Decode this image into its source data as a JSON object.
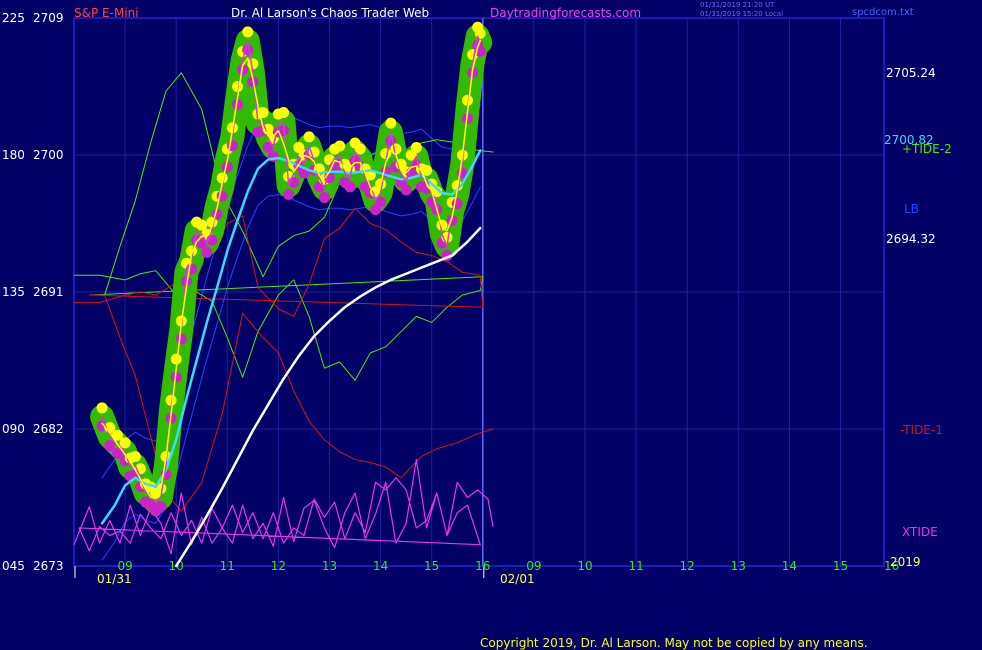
{
  "header": {
    "instrument": "S&P E-Mini",
    "title": "Dr. Al Larson's Chaos Trader Web",
    "site": "Daytradingforecasts.com",
    "timestamp_1": "01/31/2019 21:20 UT",
    "timestamp_2": "01/31/2019 15:20 Local",
    "file": "spcdcom.txt"
  },
  "footer": {
    "copyright": "Copyright 2019, Dr. Al Larson. May not be copied by any means."
  },
  "colors": {
    "background": "#000066",
    "grid": "#1f1fa0",
    "frame": "#2222dd",
    "price_dots_high": "#ffff00",
    "price_dots_low": "#cc22cc",
    "price_band": "#33bb00",
    "fast_ma": "#ffff00",
    "price_line": "#cc44cc",
    "cyan_ma": "#33ddff",
    "white_ma": "#ffffff",
    "blue_band": "#2244ff",
    "tide_plus": "#44ee00",
    "tide_minus": "#dd1111",
    "xtide": "#ee33ee"
  },
  "chart_data": {
    "type": "line",
    "title": "S&P E-Mini",
    "y_left_scale": [
      "225",
      "180",
      "135",
      "090",
      "045"
    ],
    "y_price_scale": [
      "2709",
      "2700",
      "2691",
      "2682",
      "2673"
    ],
    "y_right_labels": [
      "2705.24",
      "2700.82",
      "2694.32"
    ],
    "indicator_labels": [
      "+TIDE-2",
      "LB",
      "-TIDE-1",
      "XTIDE",
      "2019"
    ],
    "x_hours": [
      "09",
      "10",
      "11",
      "12",
      "13",
      "14",
      "15",
      "16",
      "09",
      "10",
      "11",
      "12",
      "13",
      "14",
      "15",
      "16"
    ],
    "x_dates": [
      "01/31",
      "02/01"
    ],
    "ylim": [
      2673,
      2709
    ],
    "forecast_start_hour": 16,
    "series": [
      {
        "name": "price",
        "x": [
          8.55,
          8.7,
          8.85,
          9.0,
          9.1,
          9.2,
          9.3,
          9.4,
          9.5,
          9.6,
          9.7,
          9.8,
          9.9,
          10.0,
          10.1,
          10.2,
          10.3,
          10.4,
          10.5,
          10.6,
          10.7,
          10.8,
          10.9,
          11.0,
          11.1,
          11.2,
          11.3,
          11.4,
          11.5,
          11.6,
          11.7,
          11.8,
          11.9,
          12.0,
          12.1,
          12.2,
          12.3,
          12.4,
          12.5,
          12.6,
          12.7,
          12.8,
          12.9,
          13.0,
          13.1,
          13.2,
          13.3,
          13.4,
          13.5,
          13.6,
          13.7,
          13.8,
          13.9,
          14.0,
          14.1,
          14.2,
          14.3,
          14.4,
          14.5,
          14.6,
          14.7,
          14.8,
          14.9,
          15.0,
          15.1,
          15.2,
          15.3,
          15.4,
          15.5,
          15.6,
          15.7,
          15.8,
          15.9,
          15.95
        ],
        "values": [
          2682.8,
          2681.5,
          2681.0,
          2680.5,
          2679.5,
          2679.6,
          2678.8,
          2677.8,
          2677.6,
          2677.2,
          2677.5,
          2679.6,
          2683.3,
          2686.0,
          2688.5,
          2692.3,
          2693.1,
          2695.0,
          2694.8,
          2694.2,
          2695.0,
          2696.7,
          2697.9,
          2699.8,
          2701.2,
          2703.9,
          2706.2,
          2707.5,
          2705.4,
          2702.1,
          2702.2,
          2701.1,
          2700.5,
          2702.1,
          2702.2,
          2698.0,
          2698.8,
          2699.9,
          2699.4,
          2700.6,
          2699.6,
          2698.5,
          2697.8,
          2699.1,
          2699.8,
          2700.0,
          2698.8,
          2698.5,
          2700.2,
          2699.8,
          2698.5,
          2698.1,
          2697.0,
          2697.5,
          2699.5,
          2701.5,
          2699.8,
          2698.8,
          2698.3,
          2699.4,
          2699.9,
          2698.5,
          2698.4,
          2697.5,
          2697.0,
          2694.8,
          2694.0,
          2696.3,
          2697.4,
          2699.4,
          2703.0,
          2706.0,
          2707.8,
          2707.4
        ]
      },
      {
        "name": "cyan_ma",
        "x": [
          8.55,
          8.8,
          9.0,
          9.2,
          9.4,
          9.6,
          9.8,
          10.0,
          10.2,
          10.4,
          10.6,
          10.8,
          11.0,
          11.2,
          11.4,
          11.6,
          11.8,
          12.0,
          12.2,
          12.4,
          12.6,
          12.8,
          13.0,
          13.2,
          13.4,
          13.6,
          13.8,
          14.0,
          14.2,
          14.4,
          14.6,
          14.8,
          15.0,
          15.2,
          15.4,
          15.6,
          15.8,
          15.95
        ],
        "values": [
          2675.8,
          2677.0,
          2678.3,
          2678.8,
          2678.4,
          2678.2,
          2679.3,
          2681.3,
          2684.0,
          2686.5,
          2689.0,
          2691.3,
          2693.7,
          2695.7,
          2697.6,
          2699.1,
          2699.7,
          2699.8,
          2699.6,
          2699.3,
          2699.0,
          2698.8,
          2698.9,
          2698.9,
          2698.8,
          2698.9,
          2699.0,
          2698.8,
          2698.6,
          2698.4,
          2698.5,
          2698.7,
          2698.1,
          2697.5,
          2697.4,
          2698.1,
          2699.3,
          2700.3
        ]
      },
      {
        "name": "white_ma",
        "x": [
          10.0,
          10.3,
          10.6,
          10.9,
          11.2,
          11.5,
          11.8,
          12.1,
          12.4,
          12.7,
          13.0,
          13.3,
          13.6,
          13.9,
          14.2,
          14.5,
          14.8,
          15.1,
          15.4,
          15.7,
          15.95
        ],
        "values": [
          2673.0,
          2674.6,
          2676.3,
          2678.1,
          2680.0,
          2681.9,
          2683.6,
          2685.3,
          2686.8,
          2688.1,
          2689.1,
          2690.0,
          2690.7,
          2691.3,
          2691.8,
          2692.2,
          2692.6,
          2693.0,
          2693.4,
          2694.3,
          2695.2
        ]
      },
      {
        "name": "+TIDE-2",
        "x": [
          8.0,
          8.5,
          9.0,
          9.3,
          9.6,
          10.0,
          10.4,
          10.7,
          11.0,
          11.3,
          11.6,
          12.0,
          12.3,
          12.6,
          12.9,
          13.2,
          13.5,
          13.8,
          14.1,
          14.4,
          14.7,
          15.0,
          15.3,
          15.6,
          15.95,
          16.0,
          16.3,
          16.6,
          16.9,
          17.2,
          17.5,
          17.8,
          18.1,
          18.5,
          18.9,
          19.3,
          19.7,
          20.0,
          20.3,
          20.6,
          20.9,
          21.2,
          21.5,
          21.8,
          22.1,
          22.4,
          22.8,
          23.1,
          23.5,
          23.9,
          24.2
        ],
        "values": [
          2692.1,
          2692.1,
          2691.8,
          2692.2,
          2692.4,
          2690.8,
          2691.0,
          2690.4,
          2688.0,
          2685.4,
          2688.4,
          2690.8,
          2691.8,
          2689.4,
          2686.0,
          2686.4,
          2685.2,
          2687.0,
          2687.4,
          2688.4,
          2689.4,
          2689.0,
          2690.0,
          2690.8,
          2691.1,
          2692.0,
          2690.8,
          2690.8,
          2694.0,
          2697.0,
          2700.8,
          2704.2,
          2705.4,
          2703.0,
          2697.5,
          2695.0,
          2692.0,
          2694.0,
          2694.7,
          2695.0,
          2695.9,
          2698.2,
          2699.8,
          2700.0,
          2700.4,
          2700.2,
          2700.8,
          2701.0,
          2700.8,
          2700.3,
          2700.2
        ]
      },
      {
        "name": "-TIDE-1",
        "x": [
          8.0,
          8.5,
          9.0,
          9.3,
          9.6,
          10.0,
          10.4,
          10.7,
          11.0,
          11.3,
          11.6,
          12.0,
          12.3,
          12.6,
          12.9,
          13.2,
          13.5,
          13.8,
          14.1,
          14.4,
          14.7,
          15.0,
          15.3,
          15.6,
          15.95,
          16.0,
          16.3,
          16.6,
          16.9,
          17.2,
          17.5,
          17.8,
          18.1,
          18.5,
          18.9,
          19.3,
          19.7,
          20.0,
          20.3,
          20.6,
          20.9,
          21.2,
          21.5,
          21.8,
          22.1,
          22.4,
          22.8,
          23.1,
          23.5,
          23.9,
          24.2
        ],
        "values": [
          2690.3,
          2690.3,
          2690.8,
          2691.0,
          2690.8,
          2691.6,
          2692.9,
          2693.6,
          2695.5,
          2696.0,
          2691.3,
          2689.9,
          2689.4,
          2691.5,
          2694.5,
          2695.2,
          2696.5,
          2695.5,
          2695.1,
          2694.3,
          2693.6,
          2693.4,
          2693.0,
          2692.3,
          2692.1,
          2690.0,
          2690.8,
          2690.8,
          2688.0,
          2685.5,
          2681.5,
          2677.8,
          2676.6,
          2678.5,
          2683.0,
          2689.6,
          2688.0,
          2687.0,
          2684.5,
          2682.5,
          2681.3,
          2680.5,
          2680.0,
          2679.8,
          2679.5,
          2678.8,
          2680.2,
          2680.7,
          2681.1,
          2681.7,
          2682.0
        ]
      },
      {
        "name": "XTIDE",
        "x": [
          8.0,
          8.3,
          8.5,
          8.7,
          8.9,
          9.1,
          9.3,
          9.5,
          9.7,
          9.9,
          10.1,
          10.3,
          10.5,
          10.7,
          10.9,
          11.1,
          11.3,
          11.5,
          11.7,
          11.9,
          12.1,
          12.3,
          12.5,
          12.7,
          12.9,
          13.1,
          13.3,
          13.5,
          13.7,
          13.9,
          14.1,
          14.3,
          14.5,
          14.7,
          14.9,
          15.1,
          15.3,
          15.5,
          15.7,
          15.95,
          16.1,
          16.3,
          16.5,
          16.7,
          16.9,
          17.1,
          17.3,
          17.5,
          17.7,
          17.9,
          18.1,
          18.3,
          18.5,
          18.7,
          18.9,
          19.1,
          19.3,
          19.5,
          19.7,
          19.9,
          20.1,
          20.3,
          20.5,
          20.7,
          20.9,
          21.1,
          21.3,
          21.5,
          21.7,
          21.9,
          22.1,
          22.3,
          22.5,
          22.7,
          22.9,
          23.1,
          23.3,
          23.5,
          23.7,
          23.9,
          24.1,
          24.2
        ],
        "values": [
          2674.4,
          2676.9,
          2674.5,
          2676.0,
          2674.5,
          2677.0,
          2675.0,
          2676.8,
          2675.8,
          2673.8,
          2677.8,
          2674.4,
          2676.2,
          2674.5,
          2675.5,
          2674.5,
          2677.0,
          2674.8,
          2675.8,
          2674.3,
          2677.5,
          2674.6,
          2676.8,
          2677.3,
          2675.5,
          2674.2,
          2676.5,
          2677.8,
          2674.8,
          2676.4,
          2678.5,
          2674.5,
          2675.8,
          2680.0,
          2675.5,
          2677.8,
          2675.0,
          2676.5,
          2677.0,
          2674.4,
          2675.5,
          2674.0,
          2675.6,
          2675.0,
          2675.3,
          2674.5,
          2676.4,
          2675.5,
          2674.8,
          2676.5,
          2675.0,
          2676.0,
          2674.5,
          2676.8,
          2675.5,
          2677.0,
          2675.2,
          2676.5,
          2674.8,
          2676.5,
          2674.5,
          2675.5,
          2675.0,
          2677.4,
          2676.2,
          2677.2,
          2674.8,
          2676.5,
          2675.2,
          2678.5,
          2678.0,
          2678.8,
          2678.0,
          2675.5,
          2676.0,
          2677.8,
          2675.0,
          2678.5,
          2677.5,
          2678.0,
          2677.4,
          2675.6
        ]
      }
    ]
  }
}
